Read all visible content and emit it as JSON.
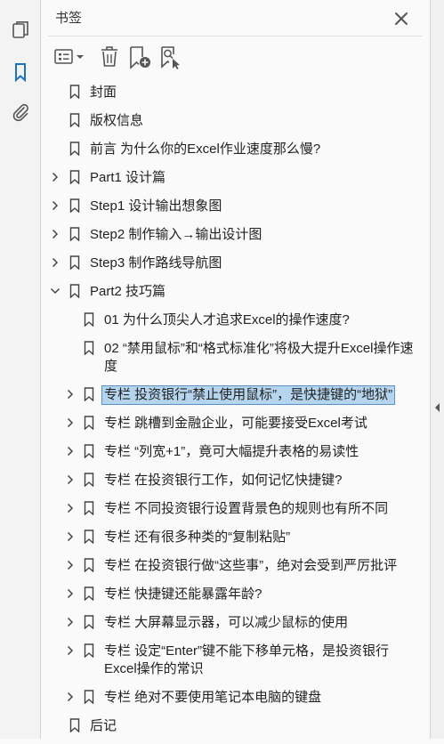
{
  "panel": {
    "title": "书签"
  },
  "toolbar": {
    "options_icon": "list-options-icon",
    "delete_icon": "trash-icon",
    "add_icon": "add-bookmark-icon",
    "find_icon": "find-bookmark-icon"
  },
  "leftbar": [
    "pages-icon",
    "bookmark-icon",
    "attachment-icon"
  ],
  "colors": {
    "accent": "#1a73c8",
    "selection": "#b5d5ee",
    "selection_border": "#5a92c7"
  },
  "bookmarks": [
    {
      "label": "封面",
      "level": 0,
      "expander": "none"
    },
    {
      "label": "版权信息",
      "level": 0,
      "expander": "none"
    },
    {
      "label": "前言 为什么你的Excel作业速度那么慢?",
      "level": 0,
      "expander": "none"
    },
    {
      "label": "Part1 设计篇",
      "level": 0,
      "expander": "collapsed"
    },
    {
      "label": "Step1 设计输出想象图",
      "level": 0,
      "expander": "collapsed"
    },
    {
      "label": "Step2 制作输入→输出设计图",
      "level": 0,
      "expander": "collapsed"
    },
    {
      "label": "Step3 制作路线导航图",
      "level": 0,
      "expander": "collapsed"
    },
    {
      "label": "Part2 技巧篇",
      "level": 0,
      "expander": "expanded"
    },
    {
      "label": "01 为什么顶尖人才追求Excel的操作速度?",
      "level": 1,
      "expander": "none"
    },
    {
      "label": "02 “禁用鼠标”和“格式标准化”将极大提升Excel操作速度",
      "level": 1,
      "expander": "none"
    },
    {
      "label": "专栏 投资银行“禁止使用鼠标”，是快捷键的“地狱”",
      "level": 1,
      "expander": "collapsed",
      "selected": true
    },
    {
      "label": "专栏 跳槽到金融企业，可能要接受Excel考试",
      "level": 1,
      "expander": "collapsed"
    },
    {
      "label": "专栏 “列宽+1”，竟可大幅提升表格的易读性",
      "level": 1,
      "expander": "collapsed"
    },
    {
      "label": "专栏 在投资银行工作，如何记忆快捷键?",
      "level": 1,
      "expander": "collapsed"
    },
    {
      "label": "专栏 不同投资银行设置背景色的规则也有所不同",
      "level": 1,
      "expander": "collapsed"
    },
    {
      "label": "专栏 还有很多种类的“复制粘贴”",
      "level": 1,
      "expander": "collapsed"
    },
    {
      "label": "专栏 在投资银行做“这些事”，绝对会受到严厉批评",
      "level": 1,
      "expander": "collapsed"
    },
    {
      "label": "专栏 快捷键还能暴露年龄?",
      "level": 1,
      "expander": "collapsed"
    },
    {
      "label": "专栏 大屏幕显示器，可以减少鼠标的使用",
      "level": 1,
      "expander": "collapsed"
    },
    {
      "label": "专栏 设定“Enter”键不能下移单元格，是投资银行Excel操作的常识",
      "level": 1,
      "expander": "collapsed"
    },
    {
      "label": "专栏 绝对不要使用笔记本电脑的键盘",
      "level": 1,
      "expander": "collapsed"
    },
    {
      "label": "后记",
      "level": 0,
      "expander": "none"
    }
  ]
}
